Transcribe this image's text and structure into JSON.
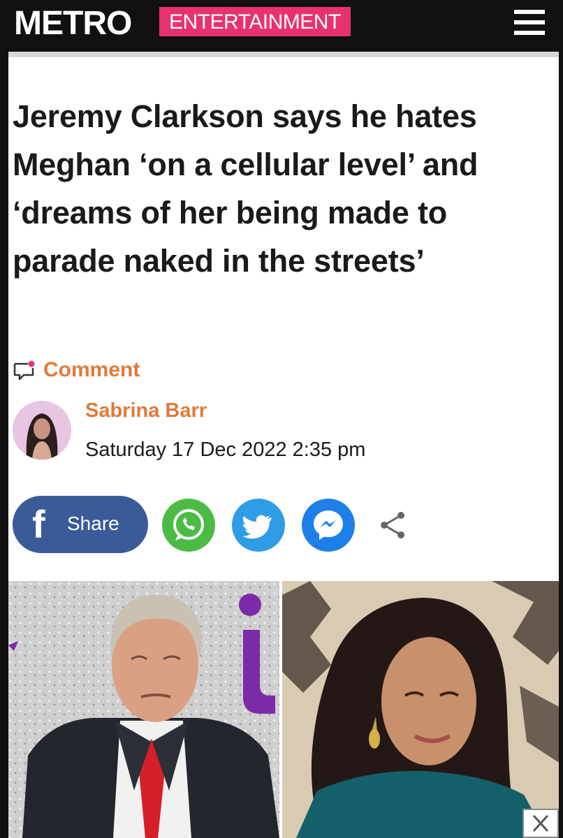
{
  "header": {
    "logo": "METRO",
    "section": "ENTERTAINMENT",
    "menu_icon": "hamburger-menu-icon"
  },
  "article": {
    "headline": "Jeremy Clarkson says he hates Meghan ‘on a cellular level’ and ‘dreams of her being made to parade naked in the streets’",
    "comment_label": "Comment",
    "author": "Sabrina Barr",
    "date": "Saturday 17 Dec 2022 2:35 pm"
  },
  "share": {
    "facebook_icon_glyph": "f",
    "facebook_label": "Share",
    "icons": [
      "whatsapp-icon",
      "twitter-icon",
      "messenger-icon",
      "share-icon"
    ]
  },
  "colors": {
    "header_bg": "#111111",
    "section_pill": "#e8326e",
    "accent_orange": "#e07a3a",
    "facebook": "#3b5b98",
    "whatsapp": "#4cbb45",
    "twitter": "#2f9ce6",
    "messenger": "#1f7fe8"
  }
}
